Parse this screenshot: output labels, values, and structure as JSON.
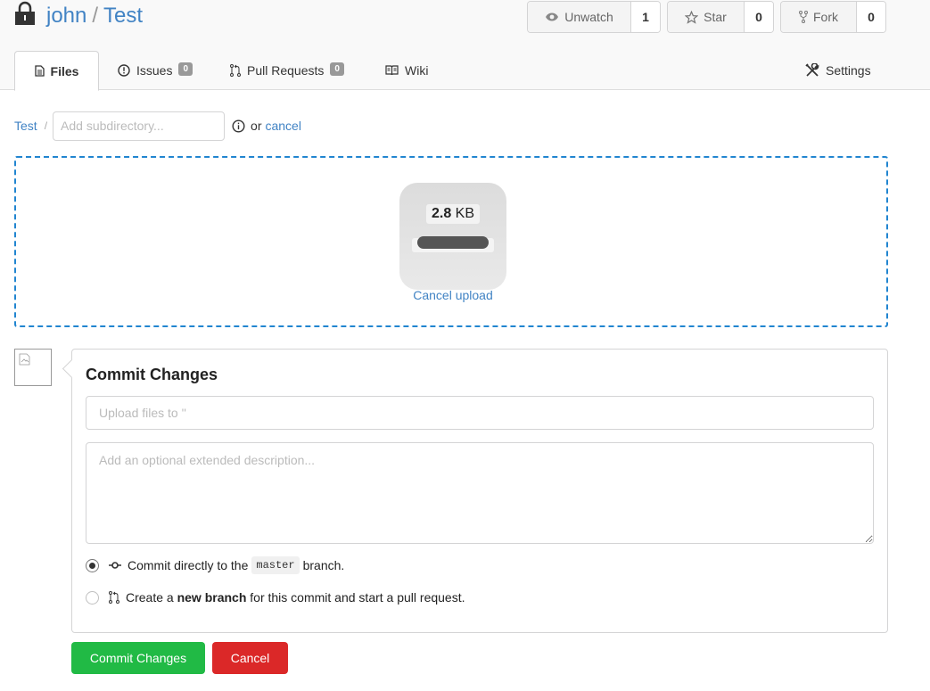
{
  "repo": {
    "owner": "john",
    "separator": "/",
    "name": "Test"
  },
  "actions": {
    "watch": {
      "label": "Unwatch",
      "count": "1",
      "icon": "eye-icon"
    },
    "star": {
      "label": "Star",
      "count": "0",
      "icon": "star-icon"
    },
    "fork": {
      "label": "Fork",
      "count": "0",
      "icon": "fork-icon"
    }
  },
  "tabs": {
    "files": {
      "label": "Files",
      "icon": "file-icon"
    },
    "issues": {
      "label": "Issues",
      "badge": "0",
      "icon": "issue-icon"
    },
    "pulls": {
      "label": "Pull Requests",
      "badge": "0",
      "icon": "pull-request-icon"
    },
    "wiki": {
      "label": "Wiki",
      "icon": "book-icon"
    },
    "settings": {
      "label": "Settings",
      "icon": "tools-icon"
    }
  },
  "breadcrumb": {
    "root": "Test",
    "divider": "/",
    "subdir_placeholder": "Add subdirectory...",
    "or_text": "or",
    "cancel_label": "cancel"
  },
  "upload": {
    "size_value": "2.8",
    "size_unit": "KB",
    "cancel_label": "Cancel upload"
  },
  "commit": {
    "title": "Commit Changes",
    "summary_placeholder": "Upload files to ''",
    "description_placeholder": "Add an optional extended description...",
    "option_direct": {
      "before": "Commit directly to the",
      "branch": "master",
      "after": "branch.",
      "selected": true
    },
    "option_new_branch": {
      "before": "Create a",
      "strong": "new branch",
      "after": "for this commit and start a pull request.",
      "selected": false
    },
    "commit_button": "Commit Changes",
    "cancel_button": "Cancel"
  },
  "colors": {
    "link": "#4183c4",
    "dropzone_border": "#2185d0",
    "commit_button": "#21ba45",
    "cancel_button": "#db2828"
  }
}
